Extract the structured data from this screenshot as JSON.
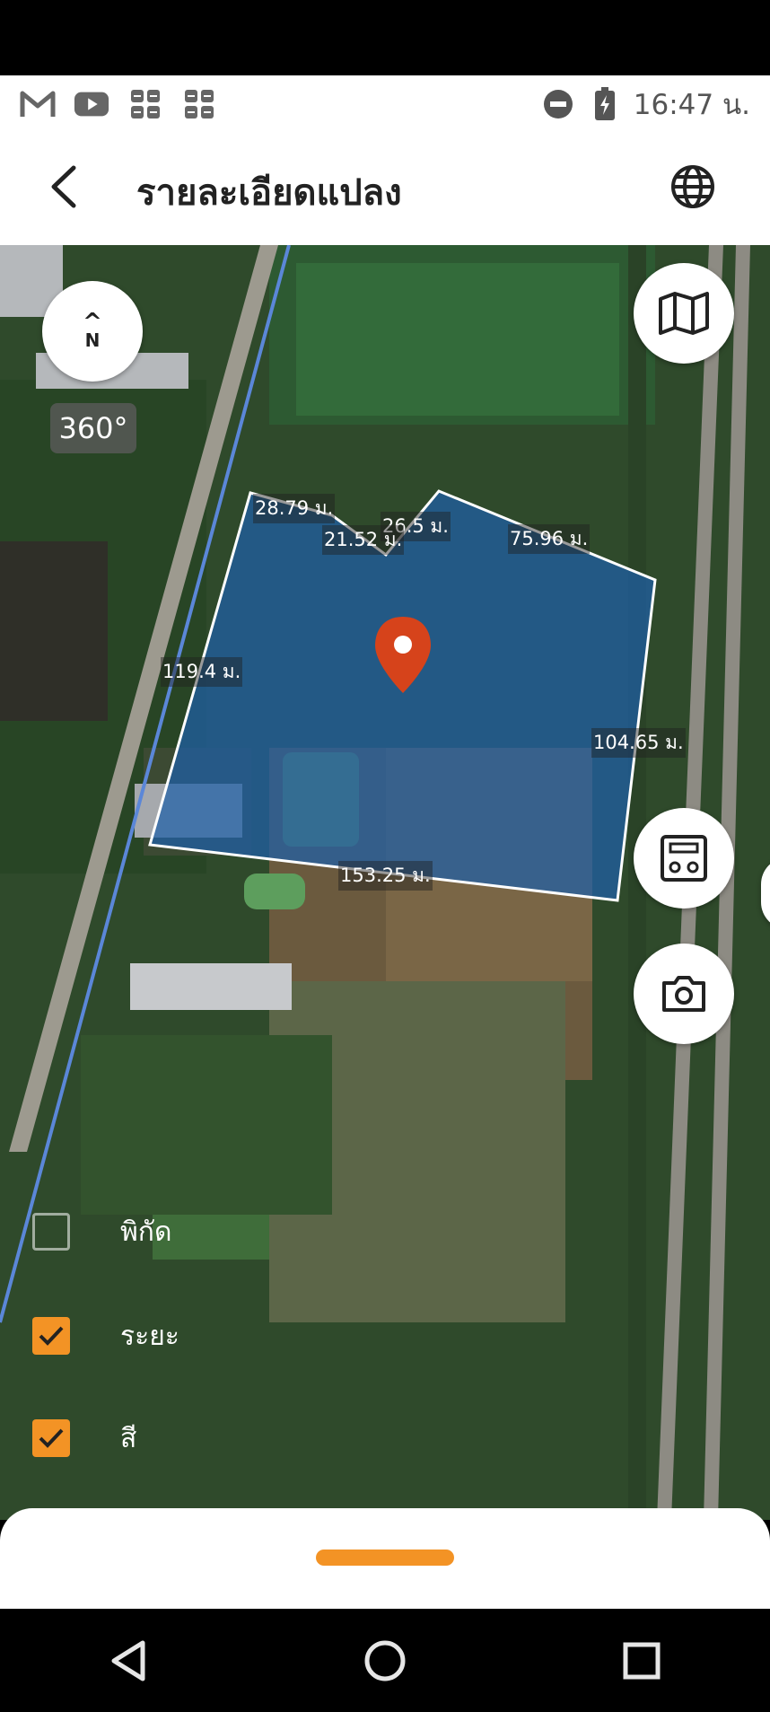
{
  "status_bar": {
    "time": "16:47 น.",
    "icons": [
      "gmail-icon",
      "youtube-icon",
      "app-grid-icon",
      "app-grid-icon",
      "do-not-disturb-icon",
      "battery-charging-icon"
    ]
  },
  "app_bar": {
    "title": "รายละเอียดแปลง",
    "back_icon": "back-arrow-icon",
    "language_icon": "globe-icon"
  },
  "map": {
    "compass": {
      "arrow": "^",
      "label": "N"
    },
    "view_360_label": "360°",
    "measurements": [
      "28.79 ม.",
      "26.5 ม.",
      "21.52 ม.",
      "75.96 ม.",
      "119.4 ม.",
      "104.65 ม.",
      "153.25 ม."
    ],
    "plot_fill_color": "#1f5fa8",
    "marker_color": "#d6431b",
    "buttons": [
      "map-layers-icon",
      "calculator-icon",
      "camera-icon"
    ]
  },
  "toggles": [
    {
      "label": "พิกัด",
      "checked": false
    },
    {
      "label": "ระยะ",
      "checked": true
    },
    {
      "label": "สี",
      "checked": true
    }
  ],
  "accent_color": "#f39325",
  "nav": [
    "back-triangle-icon",
    "home-circle-icon",
    "recents-square-icon"
  ]
}
